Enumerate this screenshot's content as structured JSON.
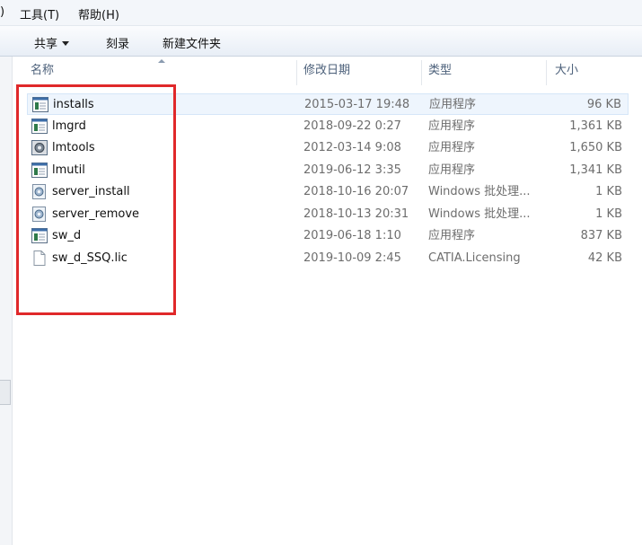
{
  "menubar": {
    "partial": ")",
    "tools": "工具(T)",
    "help": "帮助(H)"
  },
  "toolbar": {
    "share": "共享",
    "burn": "刻录",
    "new_folder": "新建文件夹"
  },
  "columns": {
    "name": "名称",
    "modified": "修改日期",
    "type": "类型",
    "size": "大小"
  },
  "files": [
    {
      "name": "installs",
      "modified": "2015-03-17 19:48",
      "type": "应用程序",
      "size": "96 KB",
      "icon": "app-icon",
      "selected": true
    },
    {
      "name": "lmgrd",
      "modified": "2018-09-22 0:27",
      "type": "应用程序",
      "size": "1,361 KB",
      "icon": "app-icon"
    },
    {
      "name": "lmtools",
      "modified": "2012-03-14 9:08",
      "type": "应用程序",
      "size": "1,650 KB",
      "icon": "gear-app-icon"
    },
    {
      "name": "lmutil",
      "modified": "2019-06-12 3:35",
      "type": "应用程序",
      "size": "1,341 KB",
      "icon": "app-icon"
    },
    {
      "name": "server_install",
      "modified": "2018-10-16 20:07",
      "type": "Windows 批处理...",
      "size": "1 KB",
      "icon": "batch-file-icon"
    },
    {
      "name": "server_remove",
      "modified": "2018-10-13 20:31",
      "type": "Windows 批处理...",
      "size": "1 KB",
      "icon": "batch-file-icon"
    },
    {
      "name": "sw_d",
      "modified": "2019-06-18 1:10",
      "type": "应用程序",
      "size": "837 KB",
      "icon": "app-icon"
    },
    {
      "name": "sw_d_SSQ.lic",
      "modified": "2019-10-09 2:45",
      "type": "CATIA.Licensing",
      "size": "42 KB",
      "icon": "document-icon"
    }
  ],
  "colors": {
    "annotation": "#e0282a",
    "selection": "#eef5fd",
    "header_text": "#4c607a"
  }
}
